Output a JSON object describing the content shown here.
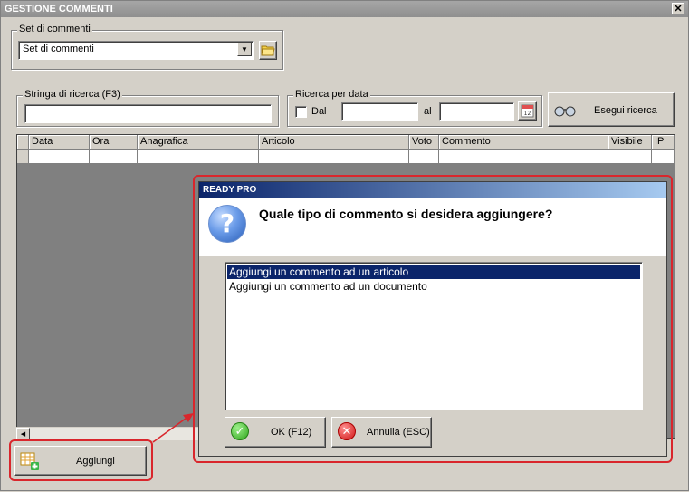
{
  "window": {
    "title": "GESTIONE COMMENTI",
    "close_glyph": "✕"
  },
  "set_group": {
    "label": "Set di commenti",
    "selected": "Set di commenti"
  },
  "search": {
    "group_label": "Stringa di ricerca (F3)",
    "value": ""
  },
  "date_search": {
    "group_label": "Ricerca per data",
    "dal_label": "Dal",
    "al_label": "al",
    "from_value": "",
    "to_value": "",
    "dal_checked": false
  },
  "search_button": {
    "label": "Esegui ricerca"
  },
  "grid": {
    "columns": [
      "Data",
      "Ora",
      "Anagrafica",
      "Articolo",
      "Voto",
      "Commento",
      "Visibile",
      "IP"
    ]
  },
  "add_button": {
    "label": "Aggiungi"
  },
  "dialog": {
    "title": "READY PRO",
    "question": "Quale tipo di commento si desidera aggiungere?",
    "options": [
      {
        "label": "Aggiungi un commento ad un articolo",
        "selected": true
      },
      {
        "label": "Aggiungi un commento ad un documento",
        "selected": false
      }
    ],
    "ok_label": "OK (F12)",
    "cancel_label": "Annulla (ESC)"
  },
  "colors": {
    "highlight_red": "#d9262c",
    "selection": "#0a246a",
    "face": "#d4d0c8"
  },
  "icons": [
    "close-icon",
    "folder-icon",
    "calendar-icon",
    "binoculars-icon",
    "add-grid-icon",
    "question-icon",
    "ok-check-icon",
    "cancel-x-icon",
    "scroll-left-icon",
    "dropdown-arrow-icon"
  ]
}
